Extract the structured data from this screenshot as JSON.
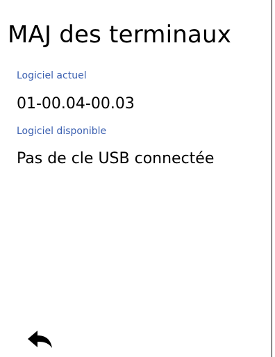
{
  "header": {
    "title": "MAJ des terminaux"
  },
  "current_software": {
    "label": "Logiciel actuel",
    "value": "01-00.04-00.03"
  },
  "available_software": {
    "label": "Logiciel disponible",
    "value": "Pas de cle USB connectée"
  },
  "footer": {
    "back_icon": "reply-arrow-icon"
  },
  "colors": {
    "label": "#3a5fb0",
    "text": "#000000",
    "background": "#ffffff"
  }
}
